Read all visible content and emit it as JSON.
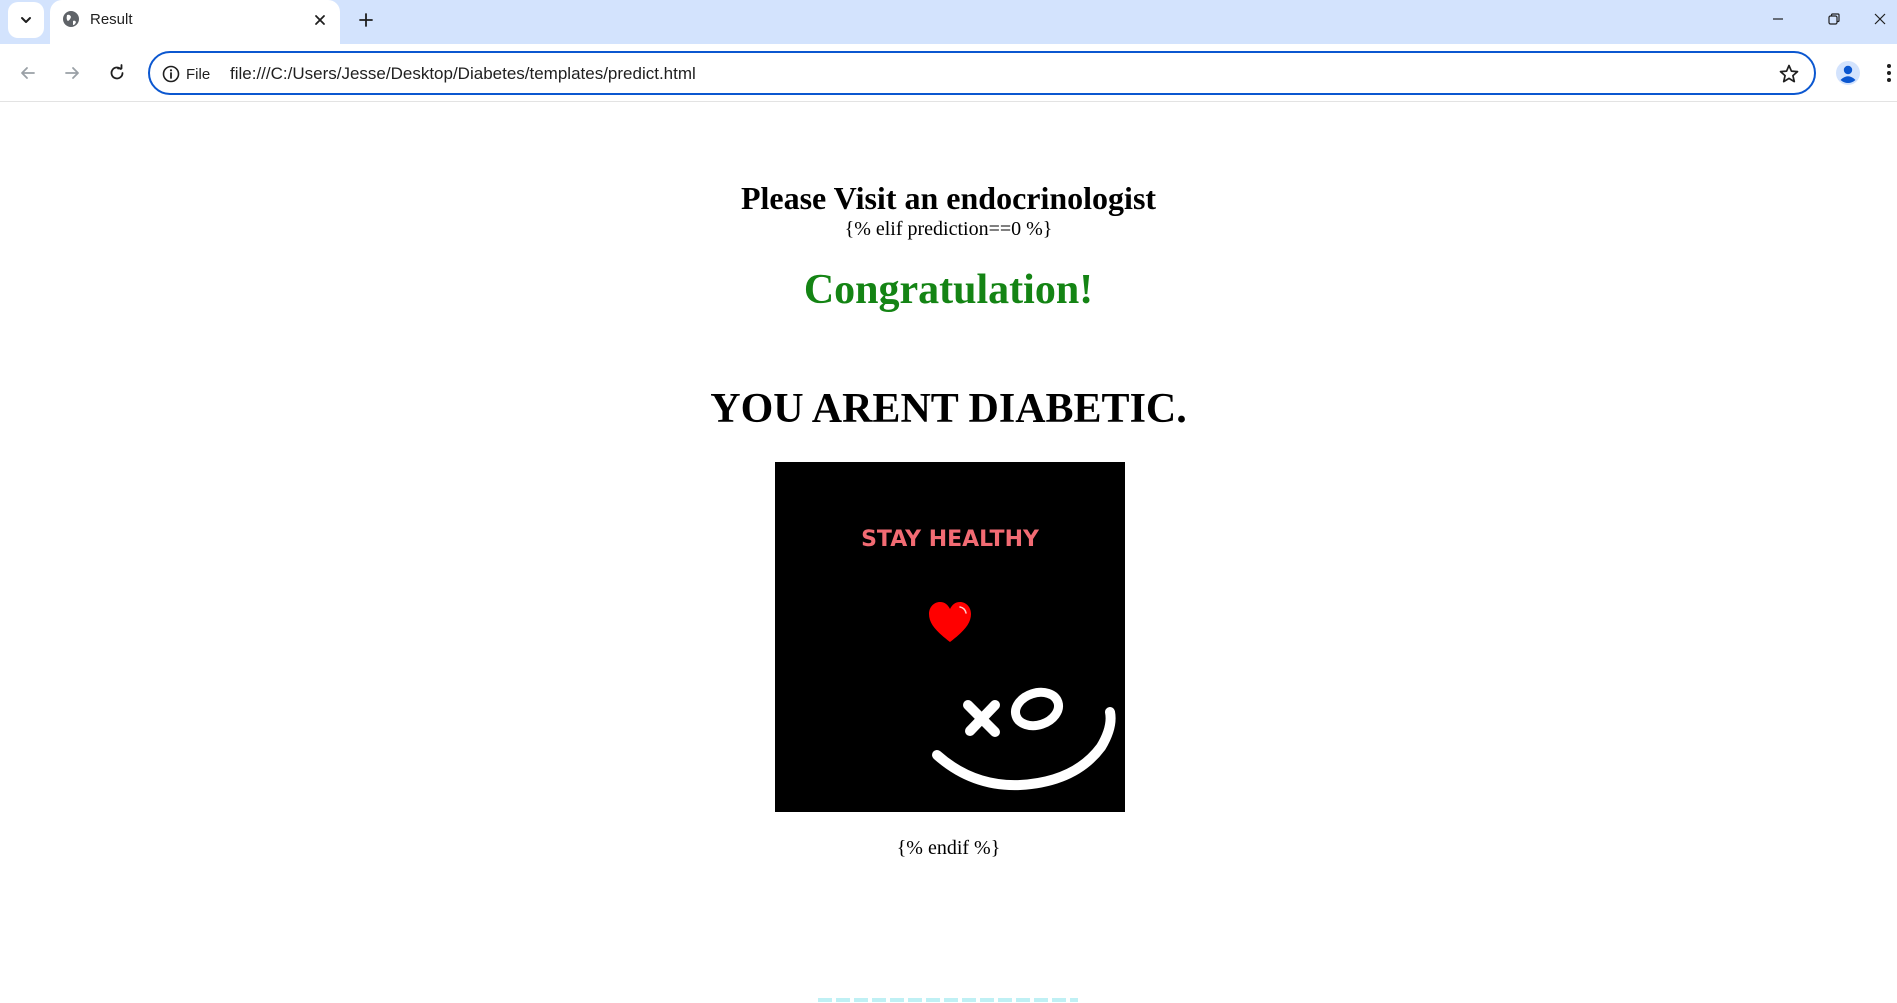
{
  "browser": {
    "tab": {
      "title": "Result",
      "favicon": "globe-icon"
    },
    "address_bar": {
      "site_info_label": "File",
      "url": "file:///C:/Users/Jesse/Desktop/Diabetes/templates/predict.html"
    },
    "colors": {
      "tabstrip": "#d3e3fd",
      "omnibox_border": "#0b57d0",
      "profile": "#0b57d0"
    },
    "icons": {
      "tab_search": "chevron-down-icon",
      "tab_close": "close-icon",
      "new_tab": "plus-icon",
      "minimize": "minimize-icon",
      "restore": "restore-icon",
      "close_window": "close-icon",
      "back": "arrow-left-icon",
      "forward": "arrow-right-icon",
      "reload": "reload-icon",
      "site_info": "info-icon",
      "bookmark": "star-icon",
      "profile": "person-icon",
      "menu": "kebab-menu-icon"
    }
  },
  "page": {
    "visit_heading": "Please Visit an endocrinologist",
    "template_elif": "{% elif prediction==0 %}",
    "congrats_heading": "Congratulation!",
    "result_heading": "YOU ARENT DIABETIC.",
    "image": {
      "caption": "STAY HEALTHY",
      "caption_color": "#f26b73",
      "heart_color": "#ff0000",
      "background": "#000000"
    },
    "template_endif": "{% endif %}",
    "colors": {
      "congrats": "#148414"
    }
  }
}
